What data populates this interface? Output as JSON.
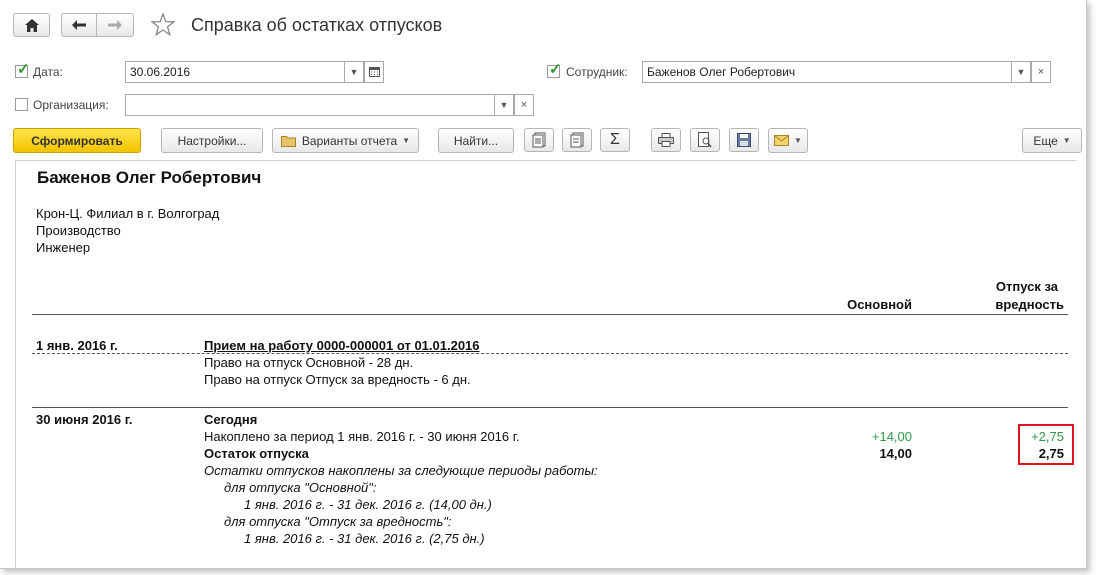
{
  "window": {
    "title": "Справка об остатках отпусков"
  },
  "nav": {
    "home_icon": "home-icon",
    "back_icon": "arrow-left-icon",
    "forward_icon": "arrow-right-icon",
    "favorite_icon": "star-icon"
  },
  "filters": {
    "date": {
      "label": "Дата:",
      "value": "30.06.2016",
      "checked": true
    },
    "employee": {
      "label": "Сотрудник:",
      "value": "Баженов Олег Робертович",
      "checked": true
    },
    "organization": {
      "label": "Организация:",
      "value": "",
      "checked": false
    }
  },
  "toolbar": {
    "generate": "Сформировать",
    "settings": "Настройки...",
    "variants": "Варианты отчета",
    "find": "Найти...",
    "more": "Еще"
  },
  "report": {
    "employee_name": "Баженов Олег Робертович",
    "org_lines": [
      "Крон-Ц. Филиал в г. Волгоград",
      "Производство",
      "Инженер"
    ],
    "columns": {
      "main": "Основной",
      "harm_line1": "Отпуск за",
      "harm_line2": "вредность"
    },
    "section1": {
      "date": "1 янв. 2016 г.",
      "heading": "Прием на работу 0000-000001 от 01.01.2016",
      "lines": [
        "Право на отпуск Основной - 28 дн.",
        "Право на отпуск Отпуск за вредность - 6 дн."
      ]
    },
    "section2": {
      "date": "30 июня 2016 г.",
      "heading": "Сегодня",
      "accrued_label": "Накоплено за период 1 янв. 2016 г. - 30 июня 2016 г.",
      "accrued_main": "+14,00",
      "accrued_harm": "+2,75",
      "balance_label": "Остаток отпуска",
      "balance_main": "14,00",
      "balance_harm": "2,75",
      "notes": [
        "Остатки отпусков накоплены за следующие периоды работы:",
        "для отпуска \"Основной\":",
        "1 янв. 2016 г. - 31 дек. 2016 г. (14,00 дн.)",
        "для отпуска \"Отпуск за вредность\":",
        "1 янв. 2016 г. - 31 дек. 2016 г. (2,75 дн.)"
      ]
    }
  },
  "colors": {
    "accent_yellow": "#f5d000",
    "positive_green": "#2e9a4a",
    "highlight_red": "#e0141e"
  }
}
